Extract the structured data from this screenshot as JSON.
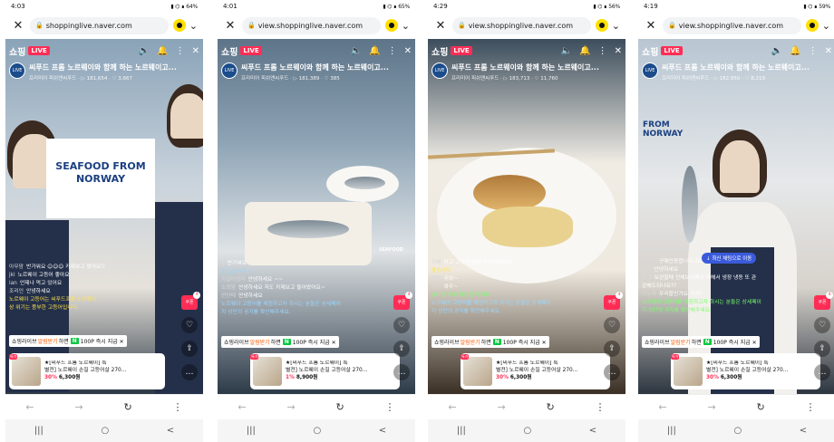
{
  "common": {
    "shop_label": "쇼핑",
    "live_label": "LIVE",
    "title": "씨푸드 프롬 노르웨이와 함께 하는 노르웨이고...",
    "channel": "프리미어 피쉬앤씨푸드",
    "promo_prefix": "쇼핑라이브",
    "promo_alarm": "알림받기",
    "promo_mid": "하면",
    "promo_npay": "N",
    "promo_points": "100P",
    "promo_suffix": "즉시 지급",
    "product_line1": "★[씨푸드 프롬 노르웨이] 특",
    "product_line2": "별전] 노르웨이 손질 고등어살 270...",
    "product_tag": "특가",
    "coupon_label": "쿠폰",
    "coupon_count": "4",
    "nav_icons": [
      "←",
      "→",
      "↻",
      "⋮"
    ],
    "sys_icons": [
      "|||",
      "○",
      "<"
    ]
  },
  "screens": [
    {
      "time": "4:03",
      "battery": "64%",
      "url": "shoppinglive.naver.com",
      "stats": "· ▷ 181,654 · ♡ 3,667",
      "chat": [
        {
          "name": "아무맘",
          "text": "반가워요 ☺☺☺ 카제보고 왔어요!!",
          "style": ""
        },
        {
          "name": "jkl",
          "text": "노르웨이 고등어 좋아요",
          "style": ""
        },
        {
          "name": "ian",
          "text": "언제나 먹고 있어요",
          "style": ""
        },
        {
          "name": "조리인",
          "text": "안녕하세요",
          "style": ""
        },
        {
          "name": "",
          "text": "노르웨이 고등어는 씨푸드프롬 노르웨이",
          "style": "y"
        },
        {
          "name": "",
          "text": "상 위기는 풍부한 고등어입니다.",
          "style": "y"
        }
      ],
      "board_text": "SEAFOOD FROM NORWAY",
      "price_pct": "30%",
      "price": "6,300원"
    },
    {
      "time": "4:01",
      "battery": "65%",
      "url": "view.shoppinglive.naver.com",
      "stats": "· ▷ 181,389 · ♡ 385",
      "chat": [
        {
          "name": "g",
          "text": "반가워요",
          "style": ""
        },
        {
          "name": "",
          "text": "반갑습니다 ~",
          "style": "b"
        },
        {
          "name": "지글이엄마",
          "text": "안녕하세요 ~~",
          "style": ""
        },
        {
          "name": "소희맘",
          "text": "안녕하세요 저도 카제보고 들어왔어요~",
          "style": ""
        },
        {
          "name": "안단테",
          "text": "안녕하세요",
          "style": ""
        },
        {
          "name": "",
          "text": "노르웨이 고등어를 체험하고자 하시는 분들은 상세페이",
          "style": "b"
        },
        {
          "name": "",
          "text": "지 상단의 공지를 확인해주세요.",
          "style": "b"
        }
      ],
      "board_text": "SEAFOOD",
      "price_pct": "1%",
      "price": "8,900원"
    },
    {
      "time": "4:29",
      "battery": "56%",
      "url": "view.shoppinglive.naver.com",
      "stats": "· ▷ 183,713 · ♡ 11,760",
      "chat": [
        {
          "name": "지혜",
          "text": "아고 고등어 진짜 맛있어보여요",
          "style": ""
        },
        {
          "name": "",
          "text": "좋습니다",
          "style": "y"
        },
        {
          "name": "빵빵",
          "text": "우와~",
          "style": ""
        },
        {
          "name": "당근",
          "text": "와우~",
          "style": ""
        },
        {
          "name": "",
          "text": "Jan 맛 최고 하는건 어때요",
          "style": "g"
        },
        {
          "name": "",
          "text": "노르웨이 고등어를 체험하고자 하시는 분들은 상세페이",
          "style": "b"
        },
        {
          "name": "",
          "text": "지 상단의 공지를 확인해주세요.",
          "style": "b"
        }
      ],
      "board_text": "",
      "price_pct": "30%",
      "price": "6,300원"
    },
    {
      "time": "4:19",
      "battery": "59%",
      "url": "view.shoppinglive.naver.com",
      "stats": "· ▷ 182,950 · ♡ 8,219",
      "chat": [
        {
          "name": "조아라",
          "text": "구매인증합니다 2021121-11400001",
          "style": ""
        },
        {
          "name": "ke1",
          "text": "안녕하세요",
          "style": ""
        },
        {
          "name": "풍이",
          "text": "보관할때 전체보지에서 다해서 냉장 냉동 또 관",
          "style": ""
        },
        {
          "name": "",
          "text": "관해도되나요??",
          "style": ""
        },
        {
          "name": "나누자",
          "text": "우리할인가요 가격?",
          "style": ""
        },
        {
          "name": "",
          "text": "노르웨이 고등어를 체험하고자 하시는 분들은 상세페이",
          "style": "g"
        },
        {
          "name": "",
          "text": "지 상단의 공지를 확인해주세요.",
          "style": "g"
        }
      ],
      "new_chat_label": "↓ 최신 채팅으로 이동",
      "board_text": "FROM NORWAY",
      "price_pct": "30%",
      "price": "6,300원"
    }
  ]
}
